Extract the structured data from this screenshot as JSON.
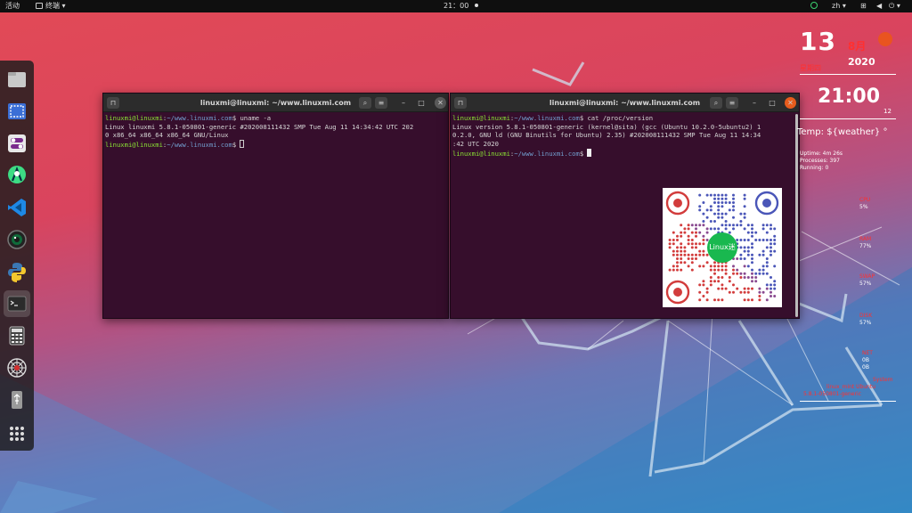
{
  "topbar": {
    "activities": "活动",
    "app_menu": "终端",
    "clock": "21：00",
    "lang": "zh"
  },
  "dock": {
    "items": [
      "files",
      "screenshot",
      "settings",
      "android-studio",
      "vscode",
      "camera",
      "python",
      "terminal",
      "calculator",
      "web-spider",
      "usb-drive",
      "show-applications"
    ]
  },
  "windows": [
    {
      "title": "linuxmi@linuxmi: ~/www.linuxmi.com",
      "prompt_user": "linuxmi@linuxmi",
      "prompt_path": "~/www.linuxmi.com",
      "cmd": "uname -a",
      "out1": "Linux linuxmi 5.8.1-050801-generic #202008111432 SMP Tue Aug 11 14:34:42 UTC 202",
      "out2": "0 x86_64 x86_64 x86_64 GNU/Linux"
    },
    {
      "title": "linuxmi@linuxmi: ~/www.linuxmi.com",
      "prompt_user": "linuxmi@linuxmi",
      "prompt_path": "~/www.linuxmi.com",
      "cmd": "cat /proc/version",
      "out1": "Linux version 5.8.1-050801-generic (kernel@sita) (gcc (Ubuntu 10.2.0-5ubuntu2) 1",
      "out2": "0.2.0, GNU ld (GNU Binutils for Ubuntu) 2.35) #202008111432 SMP Tue Aug 11 14:34",
      "out3": ":42 UTC 2020"
    }
  ],
  "qr": {
    "center_label": "Linux迷"
  },
  "conky": {
    "day": "13",
    "month": "8月",
    "weekday": "星期四",
    "year": "2020",
    "time": "21:00",
    "seconds": "12",
    "temp": "Temp: ${weather} °",
    "uptime": "Uptime: 4m 26s",
    "processes": "Processes: 397",
    "running": "Running: 0",
    "cpu_label": "CPU",
    "cpu_val": "5%",
    "ram_label": "RAM",
    "ram_val": "77%",
    "swap_label": "SWAP",
    "swap_val": "57%",
    "disk_label": "DISK",
    "disk_val": "57%",
    "net_label": "NET",
    "net_down": "0B",
    "net_up": "0B",
    "sys_label": "System",
    "sys_line1": "linux_mint Ubuntu",
    "sys_line2": "5.8.1-050801-generic"
  }
}
